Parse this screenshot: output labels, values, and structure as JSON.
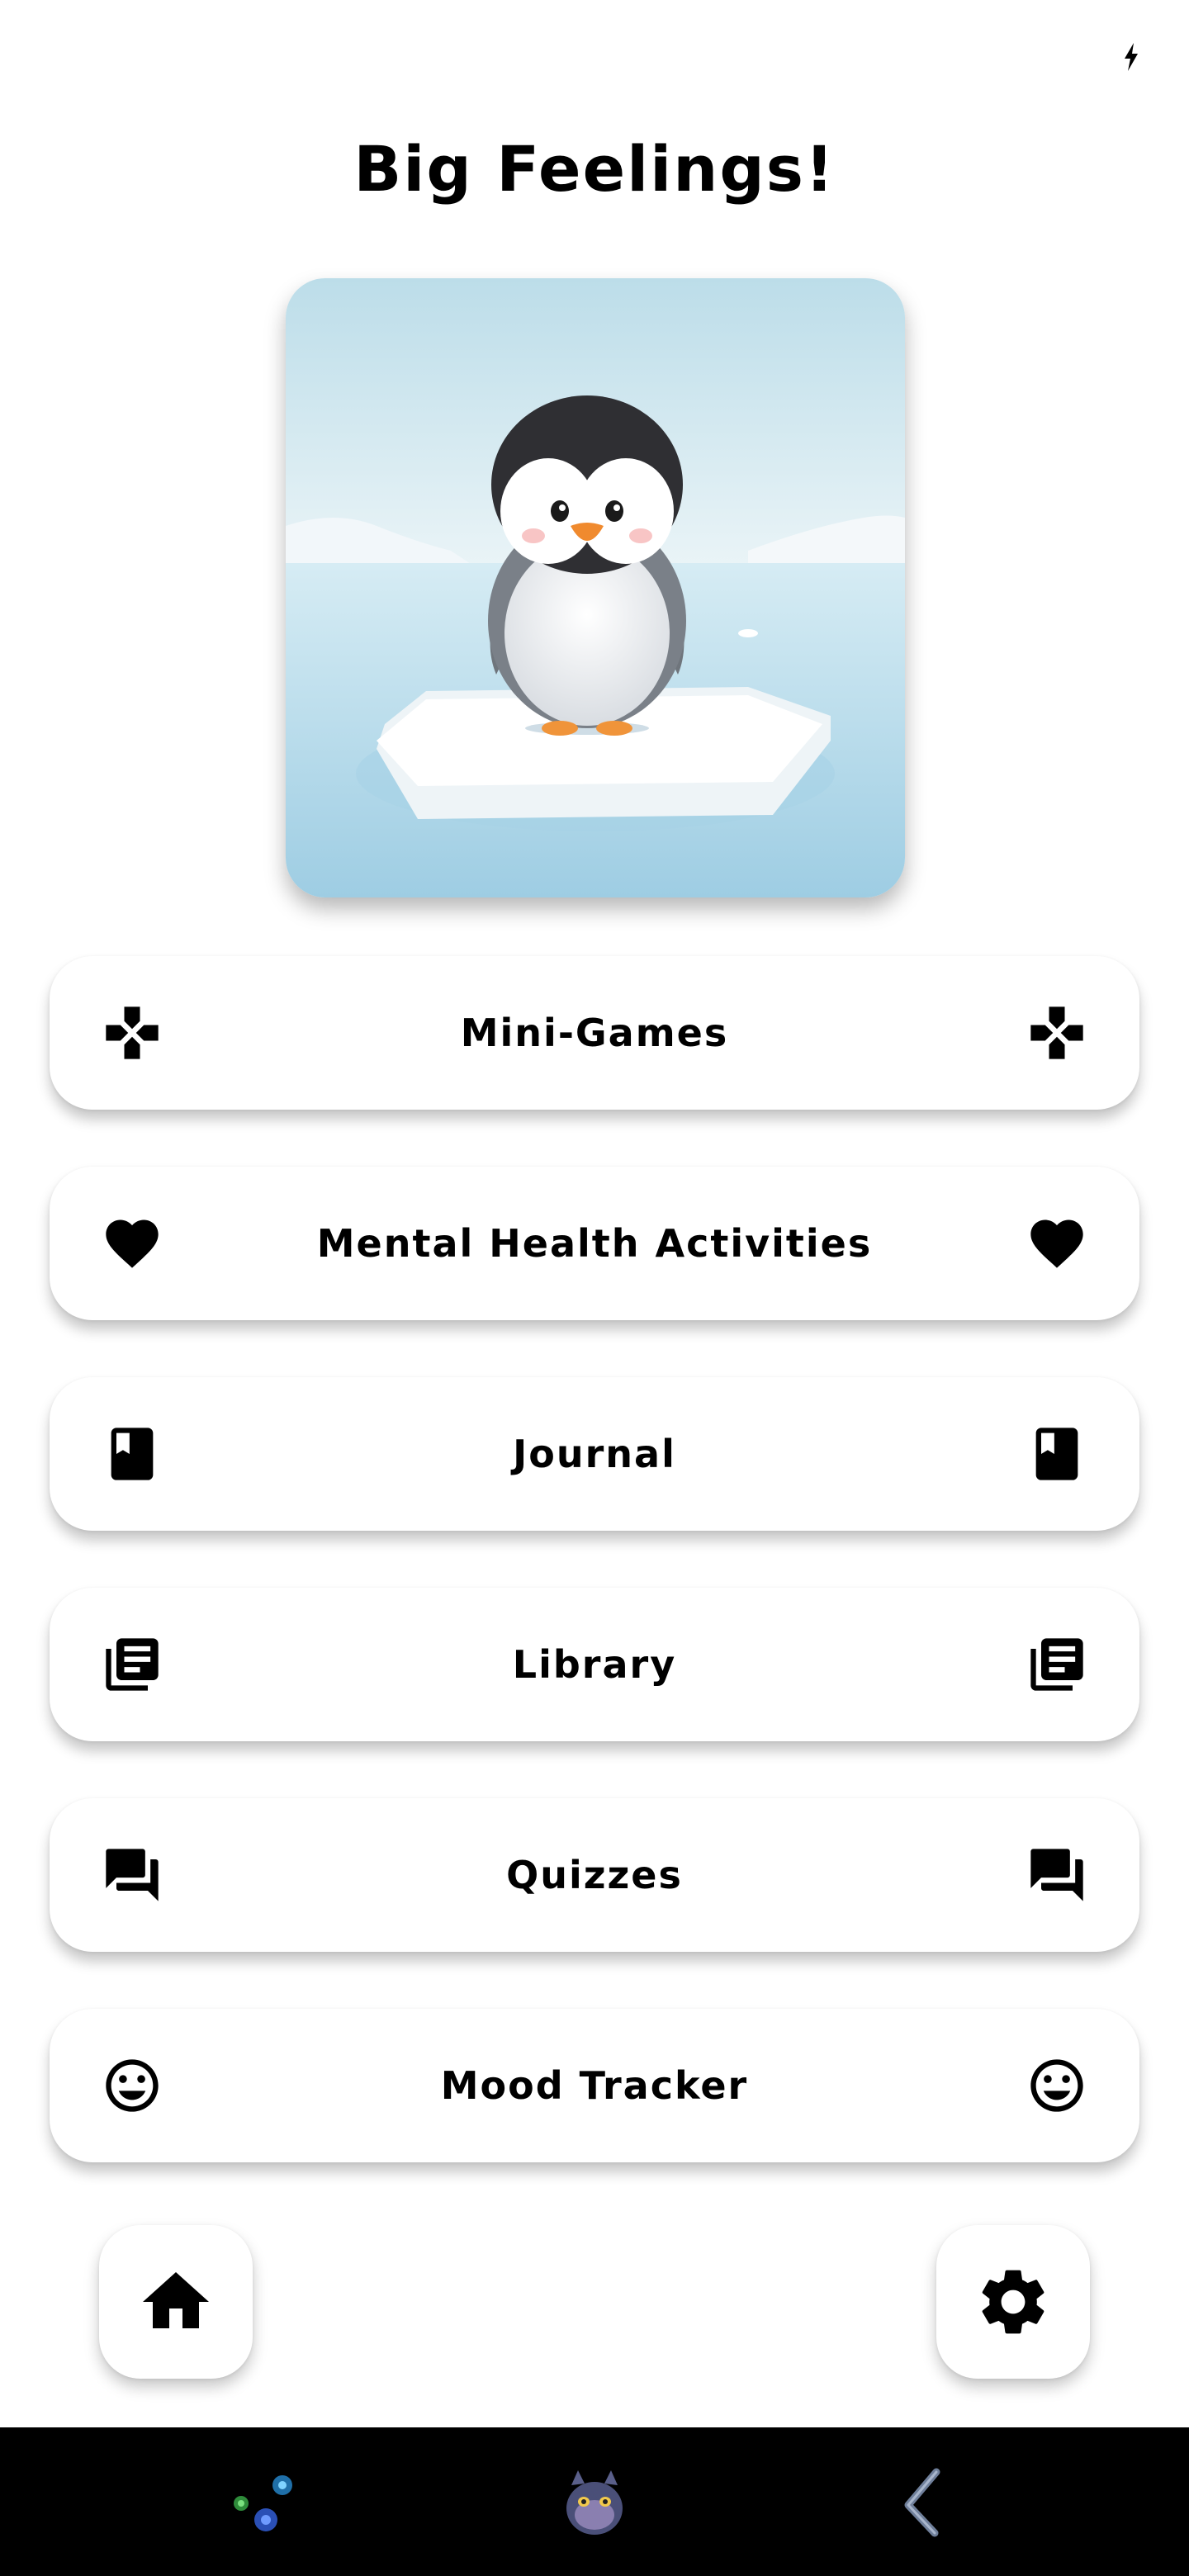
{
  "app": {
    "title": "Big Feelings!"
  },
  "hero": {
    "image": "penguin-on-ice-floe"
  },
  "menu": [
    {
      "label": "Mini-Games",
      "icon": "gamepad-icon"
    },
    {
      "label": "Mental Health Activities",
      "icon": "heart-icon"
    },
    {
      "label": "Journal",
      "icon": "book-icon"
    },
    {
      "label": "Library",
      "icon": "library-books-icon"
    },
    {
      "label": "Quizzes",
      "icon": "forum-icon"
    },
    {
      "label": "Mood Tracker",
      "icon": "smiley-face-icon"
    }
  ],
  "bottom_actions": {
    "home_icon": "home-icon",
    "settings_icon": "gear-icon"
  },
  "system_nav": [
    "apps-dots-icon",
    "creature-avatar-icon",
    "back-icon"
  ],
  "colors": {
    "background": "#ffffff",
    "button": "#ffffff",
    "text": "#000000",
    "navbar": "#000000"
  }
}
